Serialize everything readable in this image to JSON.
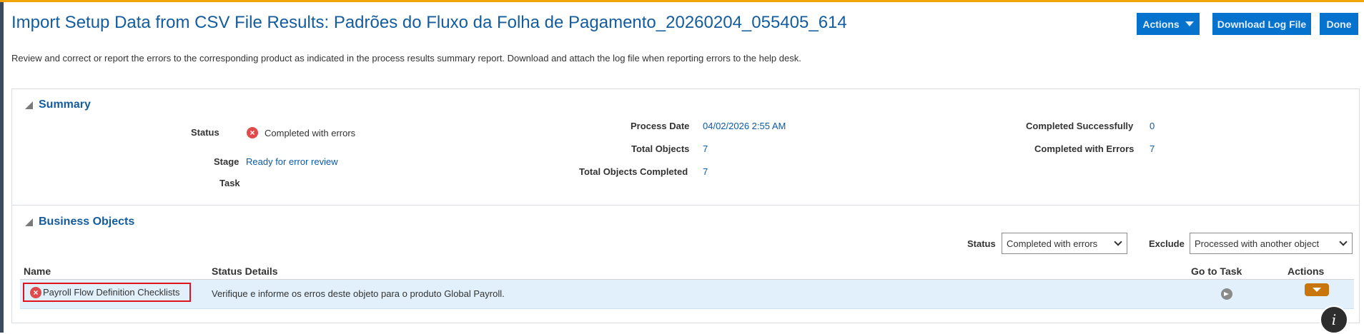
{
  "header": {
    "title": "Import Setup Data from CSV File Results: Padrões do Fluxo da Folha de Pagamento_20260204_055405_614",
    "actions_label": "Actions",
    "download_label": "Download Log File",
    "done_label": "Done",
    "instructions": "Review and correct or report the errors to the corresponding product as indicated in the process results summary report. Download and attach the log file when reporting errors to the help desk."
  },
  "summary": {
    "title": "Summary",
    "status_label": "Status",
    "status_value": "Completed with errors",
    "stage_label": "Stage",
    "stage_value": "Ready for error review",
    "task_label": "Task",
    "task_value": "",
    "process_date_label": "Process Date",
    "process_date_value": "04/02/2026 2:55 AM",
    "total_objects_label": "Total Objects",
    "total_objects_value": "7",
    "total_completed_label": "Total Objects Completed",
    "total_completed_value": "7",
    "completed_successfully_label": "Completed Successfully",
    "completed_successfully_value": "0",
    "completed_errors_label": "Completed with Errors",
    "completed_errors_value": "7"
  },
  "business_objects": {
    "title": "Business Objects",
    "filter_status_label": "Status",
    "filter_status_value": "Completed with errors",
    "filter_exclude_label": "Exclude",
    "filter_exclude_value": "Processed with another object",
    "columns": {
      "name": "Name",
      "status_details": "Status Details",
      "go_to_task": "Go to Task",
      "actions": "Actions"
    },
    "rows": [
      {
        "name": "Payroll Flow Definition Checklists",
        "status_details": "Verifique e informe os erros deste objeto para o produto Global Payroll."
      }
    ]
  },
  "icons": {
    "error": "error-circle-icon",
    "go_to_task": "arrow-circle-icon",
    "info": "info-icon"
  },
  "colors": {
    "accent": "#f0a30a",
    "primary_button": "#0572ce",
    "title": "#145c9e",
    "error": "#e04a4a",
    "row_highlight": "#e1f0fb",
    "actions_menu": "#c8760c"
  }
}
